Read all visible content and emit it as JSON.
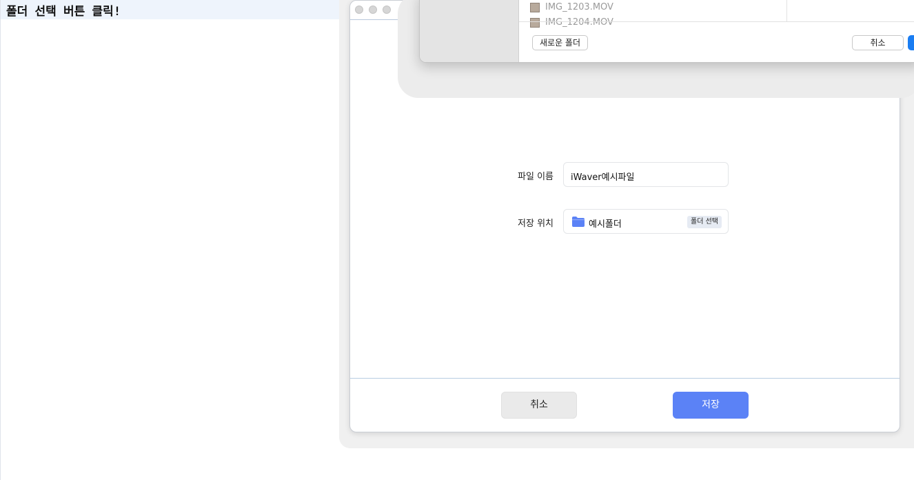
{
  "banner": {
    "text": "폴더 선택 버튼 클릭!"
  },
  "dialog": {
    "file_name_label": "파일 이름",
    "file_name_value": "iWaver예시파일",
    "location_label": "저장 위치",
    "folder_name": "예시폴더",
    "choose_folder_button": "폴더 선택",
    "cancel_button": "취소",
    "save_button": "저장"
  },
  "file_picker": {
    "files": [
      "IMG_1203.MOV",
      "IMG_1204.MOV"
    ],
    "new_folder_button": "새로운 폴더",
    "cancel_button": "취소"
  },
  "colors": {
    "save_button": "#5b82f6",
    "folder_icon": "#5b82f6",
    "picker_primary": "#1a7df2",
    "banner_bg": "#eef4fc"
  }
}
